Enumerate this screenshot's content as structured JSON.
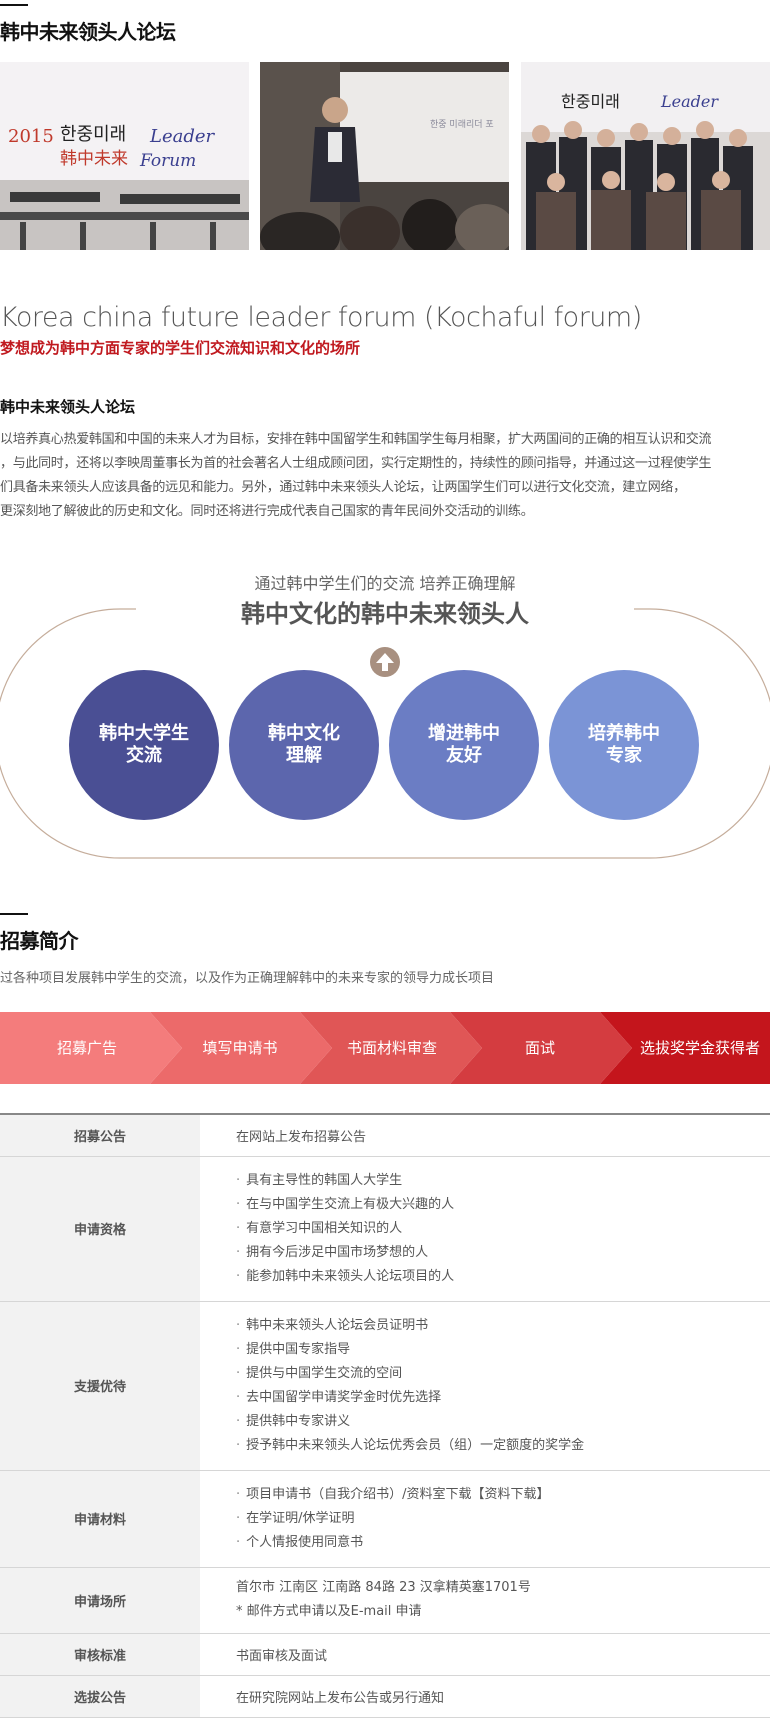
{
  "header": {
    "forum_title": "韩中未来领头人论坛"
  },
  "photos": {
    "banner_text_ko": "한중미래",
    "banner_text_en_1": "Leader",
    "banner_text_en_2": "Forum",
    "banner_text_cn": "韩中未来",
    "banner_year": "2015",
    "screen_text": "한중 미래리더 포"
  },
  "about": {
    "en_title": "Korea china future leader forum (Kochaful forum)",
    "cn_subtitle": "梦想成为韩中方面专家的学生们交流知识和文化的场所",
    "heading": "韩中未来领头人论坛",
    "paragraph_lines": [
      "以培养真心热爱韩国和中国的未来人才为目标，安排在韩中国留学生和韩国学生每月相聚，扩大两国间的正确的相互认识和交流",
      "，与此同时，还将以李映周董事长为首的社会著名人士组成顾问团，实行定期性的，持续性的顾问指导，并通过这一过程使学生",
      "们具备未来领头人应该具备的远见和能力。另外，通过韩中未来领头人论坛，让两国学生们可以进行文化交流，建立网络，",
      "更深刻地了解彼此的历史和文化。同时还将进行完成代表自己国家的青年民间外交活动的训练。"
    ]
  },
  "diagram": {
    "subtitle": "通过韩中学生们的交流 培养正确理解",
    "title": "韩中文化的韩中未来领头人",
    "circles": [
      {
        "line1": "韩中大学生",
        "line2": "交流",
        "color": "#4a4f94"
      },
      {
        "line1": "韩中文化",
        "line2": "理解",
        "color": "#5c66ad"
      },
      {
        "line1": "增进韩中",
        "line2": "友好",
        "color": "#6b7dc4"
      },
      {
        "line1": "培养韩中",
        "line2": "专家",
        "color": "#7b94d6"
      }
    ],
    "arrow_color": "#a89080"
  },
  "recruit": {
    "title": "招募简介",
    "intro": "过各种项目发展韩中学生的交流，以及作为正确理解韩中的未来专家的领导力成长项目",
    "steps": [
      {
        "label": "招募广告",
        "color": "#f47c7c"
      },
      {
        "label": "填写申请书",
        "color": "#ec6a6a"
      },
      {
        "label": "书面材料审查",
        "color": "#e05656"
      },
      {
        "label": "面试",
        "color": "#d43c40"
      },
      {
        "label": "选拔奖学金获得者",
        "color": "#c4151c"
      }
    ],
    "table": {
      "rows": [
        {
          "label": "招募公告",
          "text": "在网站上发布招募公告"
        },
        {
          "label": "申请资格",
          "items": [
            "具有主导性的韩国人大学生",
            "在与中国学生交流上有极大兴趣的人",
            "有意学习中国相关知识的人",
            "拥有今后涉足中国市场梦想的人",
            "能参加韩中未来领头人论坛项目的人"
          ]
        },
        {
          "label": "支援优待",
          "items": [
            "韩中未来领头人论坛会员证明书",
            "提供中国专家指导",
            "提供与中国学生交流的空间",
            "去中国留学申请奖学金时优先选择",
            "提供韩中专家讲义",
            "授予韩中未来领头人论坛优秀会员（组）一定额度的奖学金"
          ]
        },
        {
          "label": "申请材料",
          "items": [
            "项目申请书（自我介绍书）/资料室下载【资料下载】",
            "在学证明/休学证明",
            "个人情报使用同意书"
          ]
        },
        {
          "label": "申请场所",
          "line1": "首尔市 江南区 江南路 84路 23 汉拿精英塞1701号",
          "line2": "* 邮件方式申请以及E-mail 申请"
        },
        {
          "label": "审核标准",
          "text": "书面审核及面试"
        },
        {
          "label": "选拔公告",
          "text": "在研究院网站上发布公告或另行通知"
        }
      ]
    }
  }
}
